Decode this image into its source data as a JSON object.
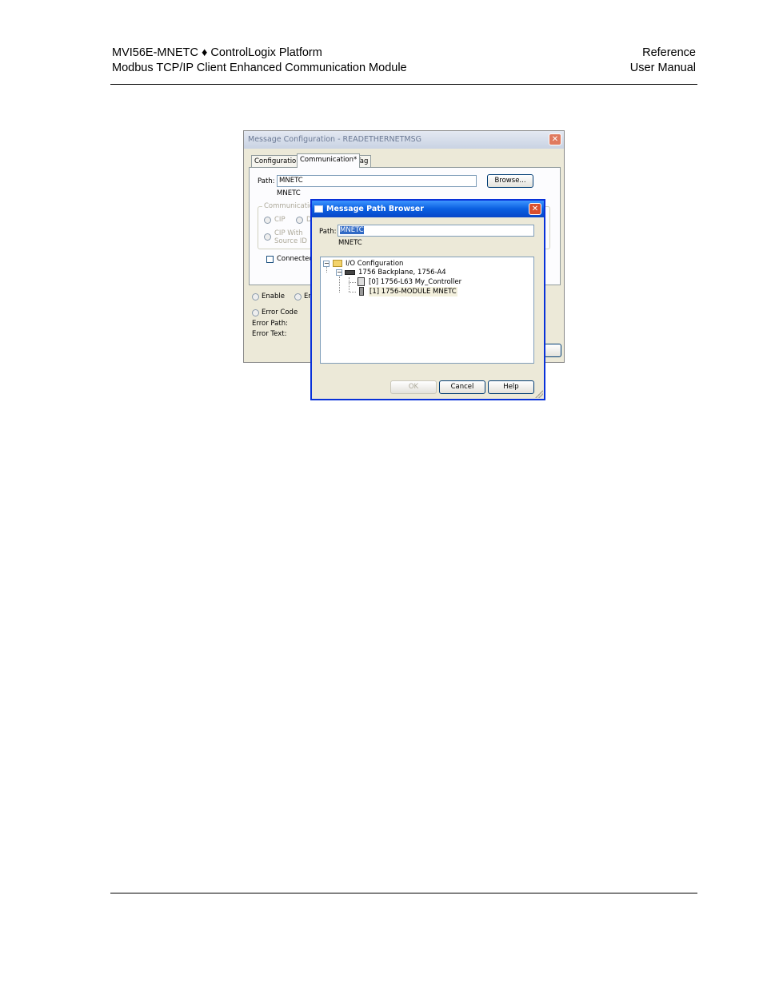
{
  "header": {
    "left_line1": "MVI56E-MNETC ♦ ControlLogix Platform",
    "left_line2": "Modbus TCP/IP Client Enhanced Communication Module",
    "right_line1": "Reference",
    "right_line2": "User Manual"
  },
  "message_config": {
    "title": "Message Configuration - READETHERNETMSG",
    "tabs": [
      "Configuration",
      "Communication*",
      "Tag"
    ],
    "path_label": "Path:",
    "path_value": "MNETC",
    "path_display": "MNETC",
    "browse_label": "Browse...",
    "comm_group_label": "Communication",
    "cip_label": "CIP",
    "d_label": "D",
    "cip_with_label": "CIP With",
    "source_id_label": "Source ID",
    "connected_label": "Connected",
    "enable_label": "Enable",
    "en_label": "En",
    "error_code_label": "Error Code",
    "error_path_label": "Error Path:",
    "error_text_label": "Error Text:"
  },
  "path_browser": {
    "title": "Message Path Browser",
    "path_label": "Path:",
    "path_value": "MNETC",
    "path_display": "MNETC",
    "tree": {
      "root": "I/O Configuration",
      "backplane": "1756 Backplane, 1756-A4",
      "controller": "[0] 1756-L63 My_Controller",
      "module": "[1] 1756-MODULE MNETC"
    },
    "ok_label": "OK",
    "cancel_label": "Cancel",
    "help_label": "Help"
  }
}
